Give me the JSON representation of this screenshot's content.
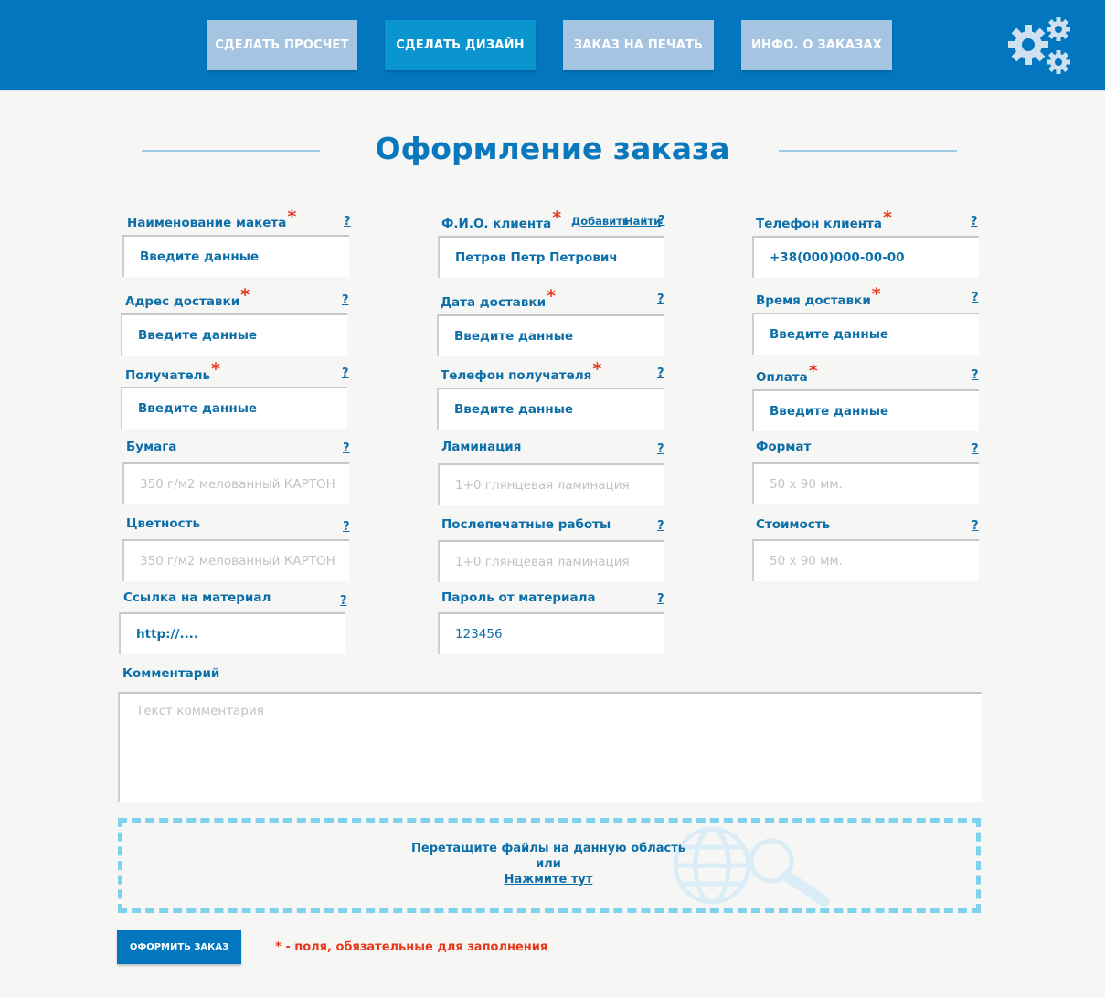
{
  "nav": [
    {
      "label": "СДЕЛАТЬ ПРОСЧЕТ"
    },
    {
      "label": "СДЕЛАТЬ ДИЗАЙН"
    },
    {
      "label": "ЗАКАЗ НА ПЕЧАТЬ"
    },
    {
      "label": "ИНФО. О ЗАКАЗАХ"
    }
  ],
  "title": "Оформление заказа",
  "help": "?",
  "fields": {
    "layout_name": {
      "label": "Наименование макета",
      "placeholder": "Введите данные"
    },
    "client_name": {
      "label": "Ф.И.О. клиента",
      "value": "Петров Петр Петрович",
      "add": "Добавить",
      "find": "Найти"
    },
    "client_phone": {
      "label": "Телефон клиента",
      "value": "+38(000)000-00-00"
    },
    "delivery_address": {
      "label": "Адрес доставки",
      "placeholder": "Введите данные"
    },
    "delivery_date": {
      "label": "Дата доставки",
      "placeholder": "Введите данные"
    },
    "delivery_time": {
      "label": "Время доставки",
      "placeholder": "Введите данные"
    },
    "recipient": {
      "label": "Получатель",
      "placeholder": "Введите данные"
    },
    "recipient_phone": {
      "label": "Телефон получателя",
      "placeholder": "Введите данные"
    },
    "payment": {
      "label": "Оплата",
      "placeholder": "Введите данные"
    },
    "paper": {
      "label": "Бумага",
      "placeholder": "350 г/м2 мелованный КАРТОН"
    },
    "lamination": {
      "label": "Ламинация",
      "placeholder": "1+0 глянцевая ламинация"
    },
    "format": {
      "label": "Формат",
      "placeholder": "50 х 90 мм."
    },
    "color": {
      "label": "Цветность",
      "placeholder": "350 г/м2 мелованный КАРТОН"
    },
    "postpress": {
      "label": "Послепечатные работы",
      "placeholder": "1+0 глянцевая ламинация"
    },
    "cost": {
      "label": "Стоимость",
      "placeholder": "50 х 90 мм."
    },
    "material_link": {
      "label": "Ссылка на материал",
      "value": "http://...."
    },
    "material_password": {
      "label": "Пароль от материала",
      "value": "123456"
    }
  },
  "required_mark": "*",
  "comment": {
    "label": "Комментарий",
    "placeholder": "Текст комментария"
  },
  "dropzone": {
    "line1": "Перетащите файлы на данную область",
    "line2": "или",
    "link": "Нажмите тут"
  },
  "submit": "ОФОРМИТЬ ЗАКАЗ",
  "required_note": "* - поля, обязательные для заполнения"
}
